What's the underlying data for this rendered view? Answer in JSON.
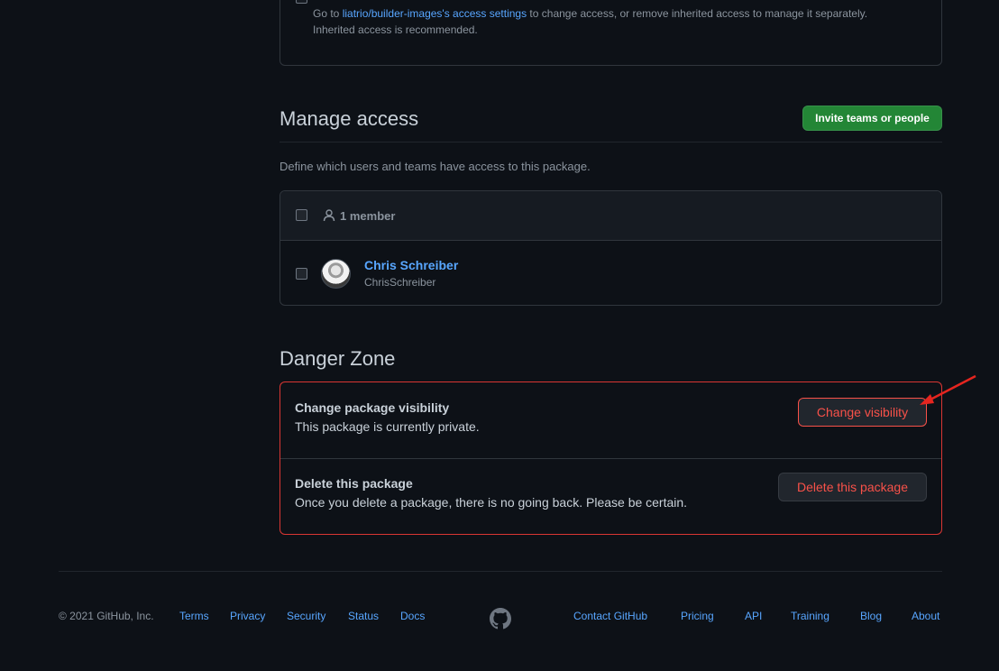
{
  "inherited": {
    "text_before": "Go to",
    "link": "liatrio/builder-images's access settings",
    "text_after": "to change access, or remove inherited access to manage it separately.",
    "text_line2": "Inherited access is recommended."
  },
  "manage": {
    "title": "Manage access",
    "invite_button": "Invite teams or people",
    "description": "Define which users and teams have access to this package.",
    "member_count": "1 member",
    "members": [
      {
        "name": "Chris Schreiber",
        "login": "ChrisSchreiber"
      }
    ]
  },
  "danger": {
    "title": "Danger Zone",
    "visibility_title": "Change package visibility",
    "visibility_text": "This package is currently private.",
    "visibility_button": "Change visibility",
    "delete_title": "Delete this package",
    "delete_text": "Once you delete a package, there is no going back. Please be certain.",
    "delete_button": "Delete this package"
  },
  "footer": {
    "copyright": "© 2021 GitHub, Inc.",
    "left_links": [
      "Terms",
      "Privacy",
      "Security",
      "Status",
      "Docs"
    ],
    "right_links": [
      "Contact GitHub",
      "Pricing",
      "API",
      "Training",
      "Blog",
      "About"
    ]
  },
  "colors": {
    "background": "#0d1117",
    "link": "#58a6ff",
    "danger": "#f85149",
    "primary": "#238636",
    "annotation_arrow": "#e5251f"
  }
}
